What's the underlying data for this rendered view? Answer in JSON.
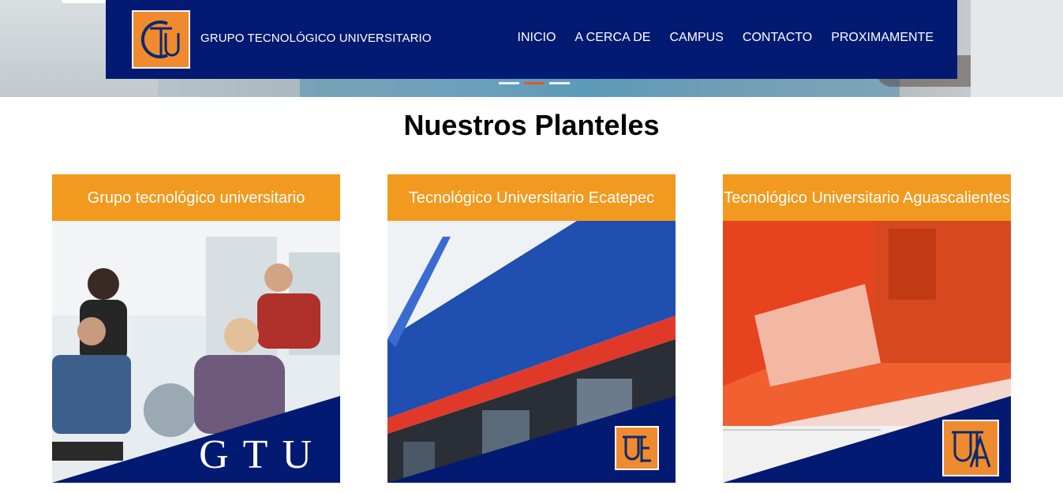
{
  "header": {
    "brand": "GRUPO TECNOLÓGICO UNIVERSITARIO",
    "nav": [
      "INICIO",
      "A CERCA DE",
      "CAMPUS",
      "CONTACTO",
      "PROXIMAMENTE"
    ]
  },
  "section": {
    "title": "Nuestros Planteles"
  },
  "cards": [
    {
      "title": "Grupo tecnológico universitario",
      "overlay": "GTU"
    },
    {
      "title": "Tecnológico Universitario Ecatepec"
    },
    {
      "title": "Tecnológico Universitario Aguascalientes"
    }
  ],
  "colors": {
    "navy": "#031a72",
    "orange": "#f29a1f"
  }
}
